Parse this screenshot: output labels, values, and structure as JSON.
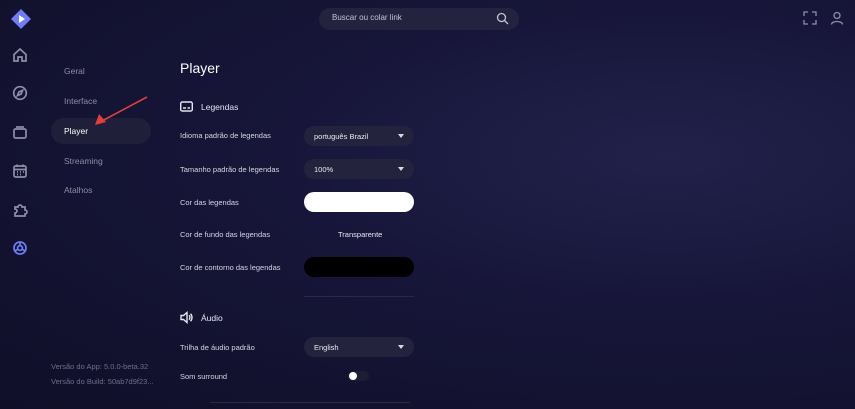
{
  "search": {
    "placeholder": "Buscar ou colar link"
  },
  "rail": [
    {
      "icon": "home-icon"
    },
    {
      "icon": "compass-icon"
    },
    {
      "icon": "library-icon"
    },
    {
      "icon": "calendar-icon"
    },
    {
      "icon": "addons-icon"
    },
    {
      "icon": "settings-icon"
    }
  ],
  "sidebar": {
    "items": [
      {
        "label": "Geral"
      },
      {
        "label": "Interface"
      },
      {
        "label": "Player"
      },
      {
        "label": "Streaming"
      },
      {
        "label": "Atalhos"
      }
    ],
    "active_index": 2,
    "version_app": "Versão do App: 5.0.0-beta.32",
    "version_build": "Versão do Build: 50ab7d9f23..."
  },
  "main": {
    "title": "Player",
    "subtitles_section": "Legendas",
    "default_language_label": "Idioma padrão de legendas",
    "default_language_value": "português Brazil",
    "default_size_label": "Tamanho padrão de legendas",
    "default_size_value": "100%",
    "color_label": "Cor das legendas",
    "color_value": "#ffffff",
    "bg_color_label": "Cor de fundo das legendas",
    "bg_color_value": "Transparente",
    "outline_color_label": "Cor de contorno das legendas",
    "outline_color_value": "#000000",
    "audio_section": "Áudio",
    "audio_track_label": "Trilha de áudio padrão",
    "audio_track_value": "English",
    "surround_label": "Som surround",
    "surround_on": false
  },
  "colors": {
    "accent": "#6f7cf6",
    "annotation_arrow": "#e0403a"
  }
}
